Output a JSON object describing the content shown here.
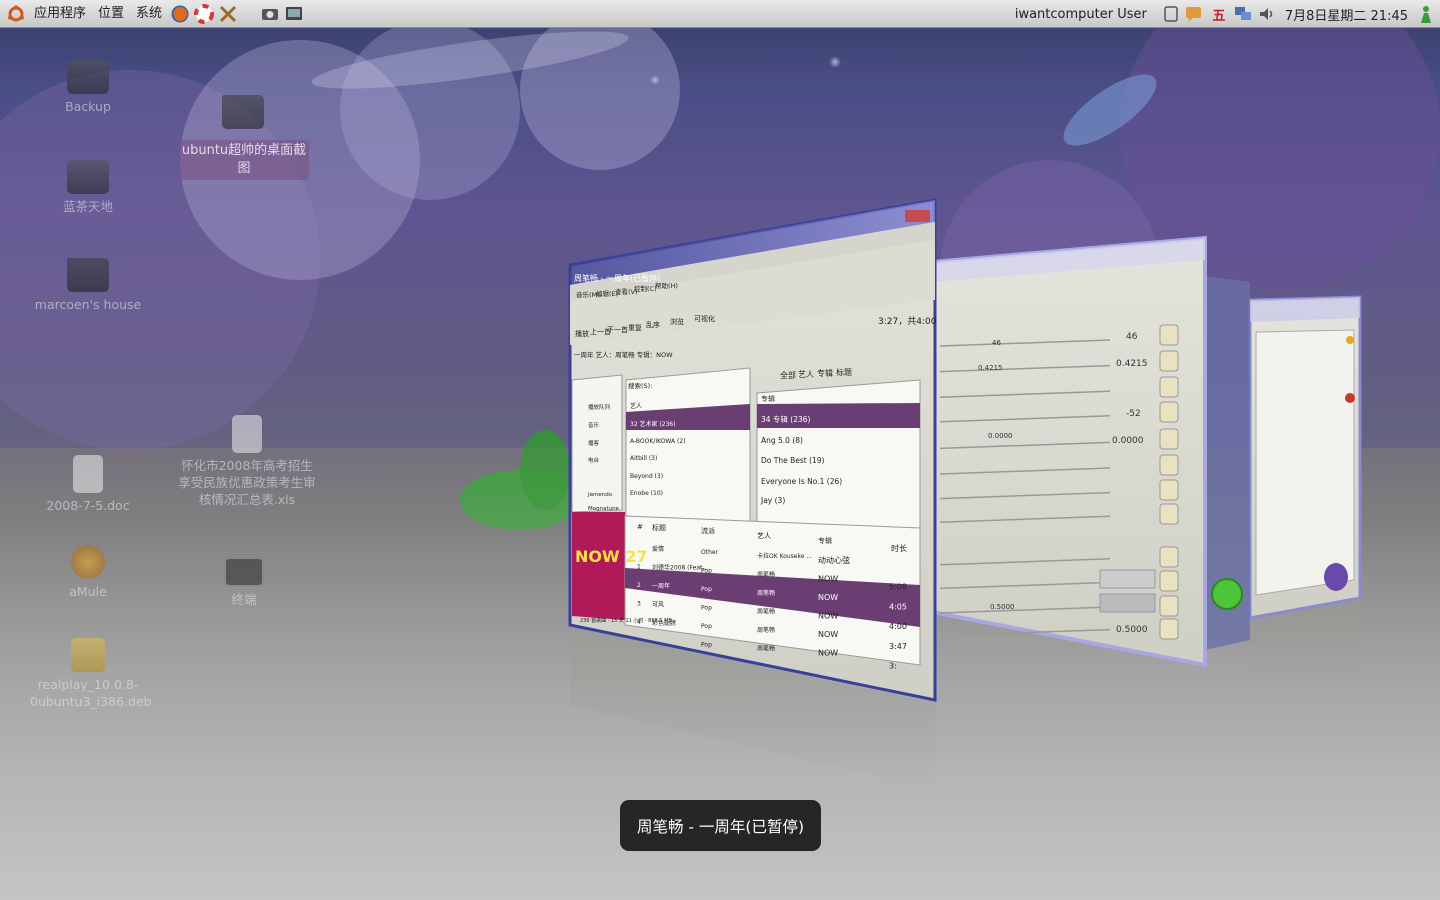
{
  "top_panel": {
    "menus": [
      "应用程序",
      "位置",
      "系统"
    ],
    "launcher_icons": [
      "firefox-icon",
      "help-icon",
      "tools-icon",
      "camera-icon",
      "screen-icon"
    ],
    "user_name": "iwantcomputer User",
    "input_method": "五",
    "clock": "7月8日星期二 21:45"
  },
  "desktop_icons": [
    {
      "name": "Backup",
      "kind": "dark"
    },
    {
      "name": "ubuntu超帅的桌面截图",
      "kind": "folder"
    },
    {
      "name": "蓝茶天地",
      "kind": "dark"
    },
    {
      "name": "marcoen's house",
      "kind": "folder"
    },
    {
      "name": "怀化市2008年高考招生享受民族优惠政策考生审核情况汇总表.xls",
      "kind": "doc"
    },
    {
      "name": "2008-7-5.doc",
      "kind": "doc"
    },
    {
      "name": "aMule",
      "kind": "amule"
    },
    {
      "name": "终端",
      "kind": "term"
    },
    {
      "name": "realplay_10.0.8-0ubuntu3_i386.deb",
      "kind": "pkg"
    }
  ],
  "player_window": {
    "title": "周笔畅 - 一周年(已暂停)",
    "menus": [
      "音乐(M)",
      "编辑(E)",
      "查看(V)",
      "控制(C)",
      "帮助(H)"
    ],
    "toolbar": [
      "播放",
      "上一首",
      "下一首",
      "重复",
      "乱序",
      "浏览",
      "可视化"
    ],
    "time": "3:27，共4:00",
    "now_playing": "一周年 艺人：周笔畅 专辑：NOW",
    "search_label": "搜索(S):",
    "filter_tabs": [
      "全部",
      "艺人",
      "专辑",
      "标题"
    ],
    "sources": [
      "播放队列",
      "音乐",
      "播客",
      "电台",
      "Jamendo",
      "Magnatune"
    ],
    "artist_header": "艺人",
    "artists": [
      "32 艺术家 (236)",
      "A-BOOK/IKOWA (2)",
      "Aitbill (3)",
      "Beyond (3)",
      "Enobe (10)"
    ],
    "album_header": "专辑",
    "albums": [
      "34 专辑 (236)",
      "Ang 5.0 (8)",
      "Do The Best (19)",
      "Everyone Is No.1 (26)",
      "Jay (3)"
    ],
    "track_columns": [
      "#",
      "标题",
      "流派",
      "艺人",
      "专辑",
      "时长"
    ],
    "tracks": [
      {
        "num": "",
        "title": "爱情",
        "genre": "Other",
        "artist": "卡拉OK Kouseke ...",
        "album": "动动心弦",
        "time": ""
      },
      {
        "num": "1",
        "title": "刘德华2008 (Feat...",
        "genre": "Pop",
        "artist": "周笔畅",
        "album": "NOW",
        "time": "5:08"
      },
      {
        "num": "2",
        "title": "一周年",
        "genre": "Pop",
        "artist": "周笔畅",
        "album": "NOW",
        "time": "4:05"
      },
      {
        "num": "3",
        "title": "可风",
        "genre": "Pop",
        "artist": "周笔畅",
        "album": "NOW",
        "time": "4:00"
      },
      {
        "num": "4",
        "title": "彩色翅膀",
        "genre": "Pop",
        "artist": "周笔畅",
        "album": "NOW",
        "time": "3:47"
      },
      {
        "num": "",
        "title": "",
        "genre": "Pop",
        "artist": "周笔畅",
        "album": "NOW",
        "time": "3:"
      }
    ],
    "album_art": "NOW 27",
    "status": "236 首歌曲 · 15 天 11 小时 · 868.5 MB"
  },
  "settings_window": {
    "values": [
      "46",
      "0.4215",
      "-52",
      "0.0000",
      "0.5000"
    ],
    "slider_labels": [
      "46",
      "0.4215",
      "0.0000",
      "0.5000"
    ]
  },
  "switcher": {
    "label": "周笔畅 - 一周年(已暂停)"
  }
}
